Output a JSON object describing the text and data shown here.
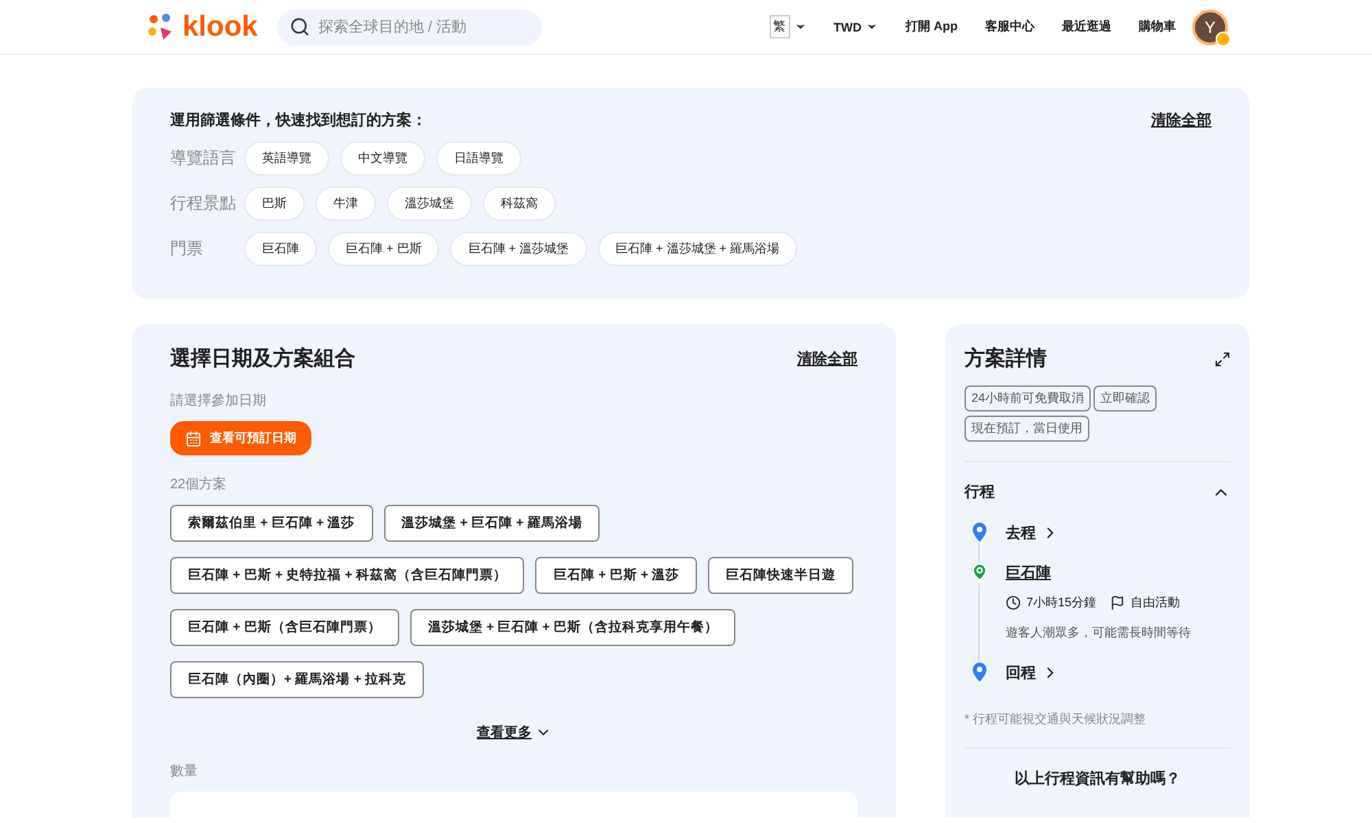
{
  "header": {
    "logo": "klook",
    "search": {
      "placeholder": "探索全球目的地 / 活動"
    },
    "language": "繁",
    "currency": "TWD",
    "links": [
      "打開 App",
      "客服中心",
      "最近逛過",
      "購物車"
    ],
    "avatar": "Y"
  },
  "filters": {
    "title": "運用篩選條件，快速找到想訂的方案：",
    "clear": "清除全部",
    "groups": [
      {
        "label": "導覽語言",
        "chips": [
          {
            "text": "英語導覽",
            "selected": false
          },
          {
            "text": "中文導覽",
            "selected": false
          },
          {
            "text": "日語導覽",
            "selected": false
          }
        ]
      },
      {
        "label": "行程景點",
        "chips": [
          {
            "text": "巴斯",
            "selected": false
          },
          {
            "text": "牛津",
            "selected": false
          },
          {
            "text": "溫莎城堡",
            "selected": false
          },
          {
            "text": "科茲窩",
            "selected": false
          }
        ]
      },
      {
        "label": "門票",
        "chips": [
          {
            "text": "巨石陣",
            "selected": false
          },
          {
            "text": "巨石陣 + 巴斯",
            "selected": false
          },
          {
            "text": "巨石陣 + 溫莎城堡",
            "selected": false
          },
          {
            "text": "巨石陣 + 溫莎城堡 + 羅馬浴場",
            "selected": false
          }
        ]
      }
    ]
  },
  "booking": {
    "title": "選擇日期及方案組合",
    "clear": "清除全部",
    "date_label": "請選擇參加日期",
    "date_button": "查看可預訂日期",
    "count": "22個方案",
    "packages": [
      {
        "text": "索爾茲伯里 + 巨石陣 + 溫莎",
        "selected": false
      },
      {
        "text": "溫莎城堡 + 巨石陣 + 羅馬浴場",
        "selected": false
      },
      {
        "text": "巨石陣 + 巴斯 + 史特拉福 + 科茲窩（含巨石陣門票）",
        "selected": false
      },
      {
        "text": "巨石陣 + 巴斯 + 溫莎",
        "selected": false
      },
      {
        "text": "巨石陣快速半日遊",
        "selected": false
      },
      {
        "text": "巨石陣 + 巴斯（含巨石陣門票）",
        "selected": false
      },
      {
        "text": "溫莎城堡 + 巨石陣 + 巴斯（含拉科克享用午餐）",
        "selected": false
      },
      {
        "text": "巨石陣（內圈）+ 羅馬浴場 + 拉科克",
        "selected": false
      }
    ],
    "more": "查看更多",
    "quantity_label": "數量"
  },
  "details": {
    "title": "方案詳情",
    "tags": [
      "24小時前可免費取消",
      "立即確認",
      "現在預訂，當日使用"
    ],
    "itinerary": {
      "title": "行程",
      "expanded": true,
      "steps": [
        {
          "kind": "transfer",
          "title": "去程"
        },
        {
          "kind": "stop",
          "title": "巨石陣",
          "duration": "7小時15分鐘",
          "activity": "自由活動",
          "note": "遊客人潮眾多，可能需長時間等待"
        },
        {
          "kind": "transfer",
          "title": "回程"
        }
      ]
    },
    "footnote": "* 行程可能視交通與天候狀況調整",
    "question": "以上行程資訊有幫助嗎？"
  }
}
